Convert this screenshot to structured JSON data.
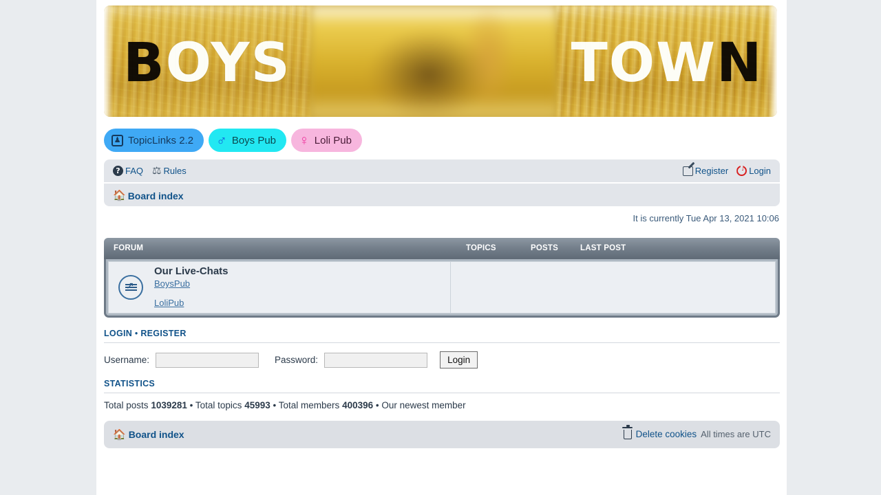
{
  "banner": {
    "left_word": "BOYS",
    "right_word": "TOWN",
    "alt": "golden wheat field banner"
  },
  "tabs": [
    {
      "label": "TopicLinks 2.2",
      "icon": "portrait-card-icon",
      "bg": "#3fa9f5"
    },
    {
      "label": "Boys Pub",
      "icon": "mars-symbol-icon",
      "glyph": "♂",
      "bg": "#22e8f2"
    },
    {
      "label": "Loli Pub",
      "icon": "venus-symbol-icon",
      "glyph": "♀",
      "bg": "#f7b6de"
    }
  ],
  "nav": {
    "faq": "FAQ",
    "faq_icon": "question-mark-icon",
    "rules": "Rules",
    "rules_icon": "scales-of-justice-icon",
    "register": "Register",
    "register_icon": "pencil-edit-icon",
    "login": "Login",
    "login_icon": "power-button-icon",
    "board_index": "Board index",
    "board_index_icon": "home-icon"
  },
  "current_time": "It is currently Tue Apr 13, 2021 10:06",
  "table": {
    "headers": {
      "forum": "FORUM",
      "topics": "TOPICS",
      "posts": "POSTS",
      "last_post": "LAST POST"
    },
    "rows": [
      {
        "icon": "external-link-forum-icon",
        "title": "Our Live-Chats",
        "links": [
          "BoysPub",
          "LoliPub"
        ],
        "topics": "",
        "posts": "",
        "last_post": ""
      }
    ]
  },
  "login_section": {
    "title_login": "LOGIN",
    "title_separator": "•",
    "title_register": "REGISTER",
    "username_label": "Username:",
    "username_value": "",
    "username_placeholder": "",
    "password_label": "Password:",
    "password_value": "",
    "password_placeholder": "",
    "submit_label": "Login"
  },
  "statistics": {
    "title": "STATISTICS",
    "total_posts_label": "Total posts",
    "total_posts": "1039281",
    "total_topics_label": "Total topics",
    "total_topics": "45993",
    "total_members_label": "Total members",
    "total_members": "400396",
    "newest_member_label": "Our newest member",
    "separator": "•"
  },
  "footer": {
    "board_index": "Board index",
    "board_index_icon": "home-icon",
    "delete_cookies": "Delete cookies",
    "delete_cookies_icon": "trash-can-icon",
    "times": "All times are UTC"
  },
  "colors": {
    "link": "#105289",
    "header_bar": "#6f7a86",
    "page_bg": "#e9ecef"
  }
}
